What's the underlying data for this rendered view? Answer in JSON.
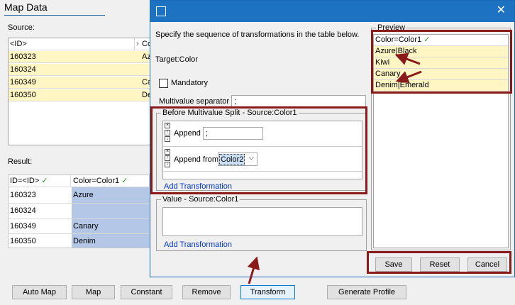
{
  "background": {
    "title": "Map Data",
    "source_label": "Source:",
    "source_grid": {
      "header": [
        "<ID>",
        "Co"
      ],
      "rows": [
        [
          "160323",
          "Az"
        ],
        [
          "160324",
          ""
        ],
        [
          "160349",
          "Ca"
        ],
        [
          "160350",
          "De"
        ]
      ]
    },
    "result_label": "Result:",
    "result_grid": {
      "header": [
        "ID=<ID>",
        "Color=Color1"
      ],
      "rows": [
        [
          "160323",
          "Azure"
        ],
        [
          "160324",
          ""
        ],
        [
          "160349",
          "Canary"
        ],
        [
          "160350",
          "Denim"
        ]
      ]
    },
    "check_glyph": "✓",
    "buttons": {
      "auto_map": "Auto Map",
      "map": "Map",
      "constant": "Constant",
      "remove": "Remove",
      "transform": "Transform",
      "generate_profile": "Generate Profile"
    }
  },
  "dialog": {
    "close_glyph": "✕",
    "instructions": "Specify the sequence of transformations in the table below.",
    "target": "Target:Color",
    "mandatory_label": "Mandatory",
    "multivalue_label": "Multivalue separator",
    "multivalue_value": ";",
    "before_split_legend": "Before Multivalue Split - Source:Color1",
    "append_label": "Append",
    "append_value": ";",
    "append_from_label": "Append from",
    "append_from_value": "Color2",
    "add_transformation": "Add Transformation",
    "value_legend": "Value - Source:Color1",
    "add_transformation_2": "Add Transformation",
    "preview_legend": "Preview",
    "preview_header": "Color=Color1",
    "preview_rows": [
      "Azure|Black",
      "Kiwi",
      "Canary",
      "Denim|Emerald"
    ],
    "save_label": "Save",
    "reset_label": "Reset",
    "cancel_label": "Cancel"
  },
  "colors": {
    "accent": "#1d72c2",
    "highlight_box": "#8b1a1a",
    "yellow_cell": "#fff6c4",
    "blue_cell": "#b4c7e7",
    "link": "#0033cc"
  }
}
